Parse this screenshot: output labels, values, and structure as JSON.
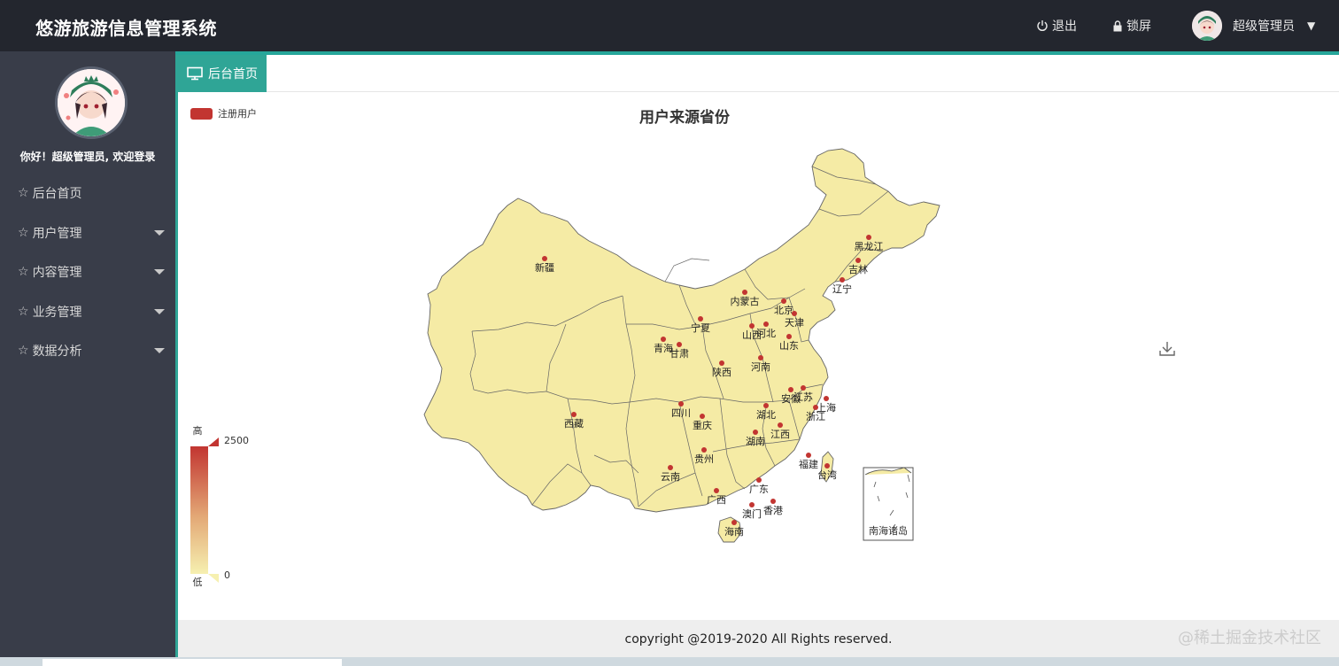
{
  "header": {
    "title": "悠游旅游信息管理系统",
    "logout_label": "退出",
    "lock_label": "锁屏",
    "user_name": "超级管理员"
  },
  "sidebar": {
    "welcome": "你好！超级管理员, 欢迎登录",
    "items": [
      {
        "label": "后台首页",
        "has_submenu": false
      },
      {
        "label": "用户管理",
        "has_submenu": true
      },
      {
        "label": "内容管理",
        "has_submenu": true
      },
      {
        "label": "业务管理",
        "has_submenu": true
      },
      {
        "label": "数据分析",
        "has_submenu": true
      }
    ]
  },
  "tabs": {
    "active": "后台首页"
  },
  "colors": {
    "header_bg": "#23262e",
    "sidebar_bg": "#393d49",
    "accent": "#2fa596",
    "map_fill": "#f5eba5",
    "point": "#c23531",
    "range_high": "#c23531",
    "range_low": "#f6f0b0"
  },
  "chart_data": {
    "type": "map",
    "title": "用户来源省份",
    "legend": [
      "注册用户"
    ],
    "visual_map": {
      "min": 0,
      "max": 2500,
      "text_high": "高",
      "text_low": "低",
      "max_label": "2500",
      "min_label": "0"
    },
    "series": [
      {
        "name": "注册用户",
        "regions": [
          "新疆",
          "西藏",
          "青海",
          "甘肃",
          "宁夏",
          "内蒙古",
          "陕西",
          "四川",
          "重庆",
          "云南",
          "贵州",
          "广西",
          "广东",
          "海南",
          "澳门",
          "香港",
          "湖南",
          "湖北",
          "江西",
          "福建",
          "台湾",
          "浙江",
          "上海",
          "江苏",
          "安徽",
          "河南",
          "山东",
          "河北",
          "北京",
          "天津",
          "山西",
          "辽宁",
          "吉林",
          "黑龙江"
        ]
      }
    ],
    "inset_label": "南海诸岛"
  },
  "footer": {
    "copyright": "copyright @2019-2020 All Rights reserved."
  },
  "watermark": "@稀土掘金技术社区"
}
